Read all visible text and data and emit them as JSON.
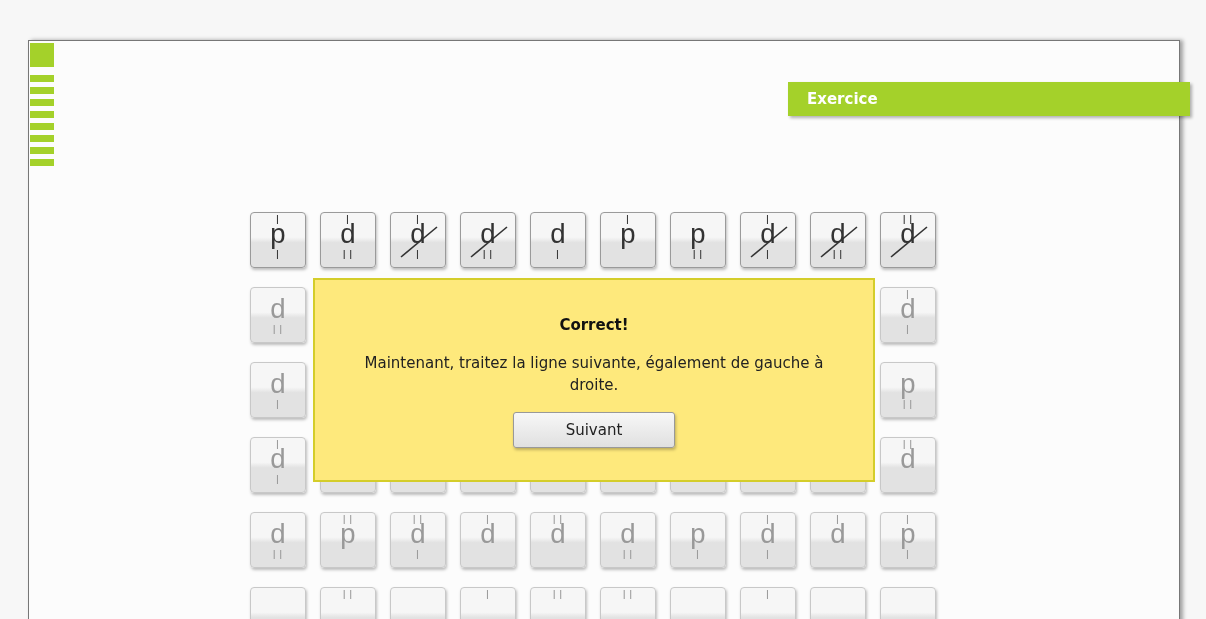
{
  "header": {
    "banner": "Exercice"
  },
  "grid": {
    "rows": [
      {
        "active": true,
        "tiles": [
          {
            "letter": "p",
            "top": "|",
            "bottom": "|",
            "crossed": false
          },
          {
            "letter": "d",
            "top": "|",
            "bottom": "||",
            "crossed": false
          },
          {
            "letter": "d",
            "top": "|",
            "bottom": "|",
            "crossed": true
          },
          {
            "letter": "d",
            "bottom": "||",
            "crossed": true
          },
          {
            "letter": "d",
            "bottom": "|",
            "crossed": false
          },
          {
            "letter": "p",
            "top": "|",
            "crossed": false
          },
          {
            "letter": "p",
            "bottom": "||",
            "crossed": false
          },
          {
            "letter": "d",
            "top": "|",
            "bottom": "|",
            "crossed": true
          },
          {
            "letter": "d",
            "bottom": "||",
            "crossed": true
          },
          {
            "letter": "d",
            "top": "||",
            "crossed": true
          }
        ]
      },
      {
        "active": false,
        "tiles": [
          {
            "letter": "d",
            "bottom": "||",
            "crossed": false
          },
          {
            "letter": "d",
            "top": "|",
            "bottom": "|",
            "crossed": false
          }
        ]
      },
      {
        "active": false,
        "tiles": [
          {
            "letter": "d",
            "bottom": "|",
            "crossed": false
          },
          {
            "letter": "p",
            "bottom": "||",
            "crossed": false
          }
        ]
      },
      {
        "active": false,
        "tiles": [
          {
            "letter": "d",
            "top": "|",
            "bottom": "|",
            "crossed": false
          },
          {
            "letter": "d",
            "top": "||",
            "crossed": false
          }
        ]
      },
      {
        "active": false,
        "tiles": [
          {
            "letter": "d",
            "bottom": "||",
            "crossed": false
          },
          {
            "letter": "p",
            "top": "||",
            "crossed": false
          },
          {
            "letter": "d",
            "top": "||",
            "bottom": "|",
            "crossed": false
          },
          {
            "letter": "d",
            "top": "|",
            "crossed": false
          },
          {
            "letter": "d",
            "top": "||",
            "crossed": false
          },
          {
            "letter": "d",
            "bottom": "||",
            "crossed": false
          },
          {
            "letter": "p",
            "bottom": "|",
            "crossed": false
          },
          {
            "letter": "d",
            "top": "|",
            "bottom": "|",
            "crossed": false
          },
          {
            "letter": "d",
            "top": "|",
            "crossed": false
          },
          {
            "letter": "p",
            "top": "|",
            "bottom": "|",
            "crossed": false
          }
        ]
      },
      {
        "active": false,
        "tiles": [
          {
            "crossed": false
          },
          {
            "top": "||",
            "crossed": false
          },
          {
            "crossed": false
          },
          {
            "top": "|",
            "crossed": false
          },
          {
            "top": "||",
            "crossed": false
          },
          {
            "top": "||",
            "crossed": false
          },
          {
            "crossed": false
          },
          {
            "top": "|",
            "crossed": false
          },
          {
            "crossed": false
          },
          {
            "crossed": false
          }
        ]
      }
    ]
  },
  "dialog": {
    "title": "Correct!",
    "message": "Maintenant, traitez la ligne suivante, également de gauche à droite.",
    "button": "Suivant"
  }
}
